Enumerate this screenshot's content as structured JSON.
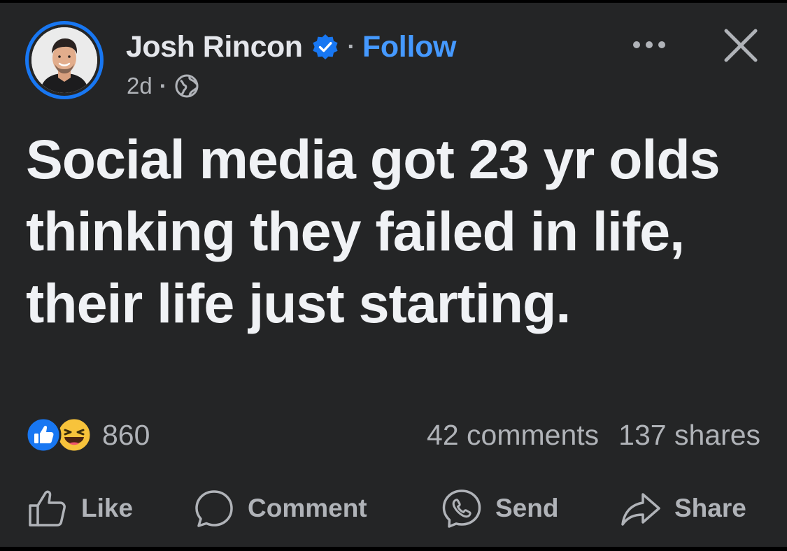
{
  "post": {
    "author": "Josh Rincon",
    "separator": "·",
    "follow_label": "Follow",
    "time": "2d",
    "meta_separator": "·",
    "text": "Social media got 23 yr olds thinking they failed in life, their life just starting."
  },
  "engagement": {
    "reaction_count": "860",
    "comments": "42 comments",
    "shares": "137 shares"
  },
  "actions": {
    "like": "Like",
    "comment": "Comment",
    "send": "Send",
    "share": "Share"
  },
  "icons": {
    "verified": "verified-badge-icon",
    "privacy": "globe-icon",
    "more": "more-options-icon",
    "close": "close-icon",
    "like_reaction": "like-reaction-icon",
    "haha_reaction": "haha-reaction-icon",
    "like_action": "thumbs-up-icon",
    "comment_action": "comment-bubble-icon",
    "send_action": "messenger-icon",
    "share_action": "share-arrow-icon"
  },
  "colors": {
    "background": "#242526",
    "primary_text": "#e4e6eb",
    "secondary_text": "#b0b3b8",
    "accent_blue": "#1877f2",
    "follow_blue": "#4599ff"
  }
}
